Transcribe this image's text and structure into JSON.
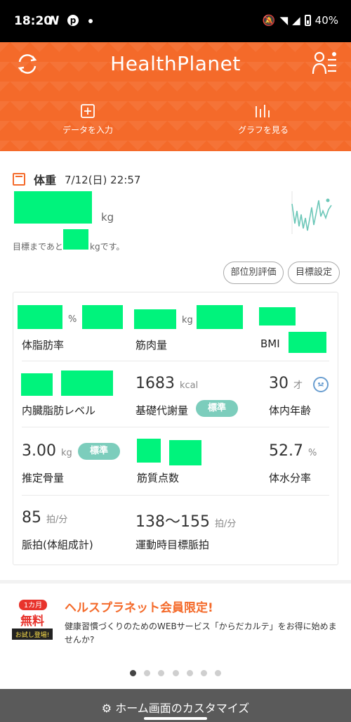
{
  "status": {
    "time": "18:20",
    "battery": "40%"
  },
  "header": {
    "title": "HealthPlanet",
    "actions": [
      {
        "label": "データを入力",
        "icon": "plus-square-icon"
      },
      {
        "label": "グラフを見る",
        "icon": "bar-chart-icon"
      }
    ]
  },
  "weight": {
    "label": "体重",
    "datetime": "7/12(日) 22:57",
    "unit": "kg",
    "goal_prefix": "目標まであと",
    "goal_suffix": "kgです。"
  },
  "buttons": {
    "part_eval": "部位別評価",
    "goal_setting": "目標設定"
  },
  "metrics": {
    "body_fat": {
      "label": "体脂肪率",
      "unit": "%"
    },
    "muscle": {
      "label": "筋肉量",
      "unit": "kg"
    },
    "bmi": {
      "label": "BMI"
    },
    "visceral": {
      "label": "内臓脂肪レベル"
    },
    "bmr": {
      "label": "基礎代謝量",
      "value": "1683",
      "unit": "kcal",
      "badge": "標準"
    },
    "body_age": {
      "label": "体内年齢",
      "value": "30",
      "unit": "才"
    },
    "bone": {
      "label": "推定骨量",
      "value": "3.00",
      "unit": "kg",
      "badge": "標準"
    },
    "muscle_score": {
      "label": "筋質点数"
    },
    "water": {
      "label": "体水分率",
      "value": "52.7",
      "unit": "%"
    },
    "pulse": {
      "label": "脈拍(体組成計)",
      "value": "85",
      "unit": "拍/分"
    },
    "target_pulse": {
      "label": "運動時目標脈拍",
      "value": "138〜155",
      "unit": "拍/分"
    }
  },
  "promo": {
    "badge_text": "1カ月 無料 お試し登場!",
    "title": "ヘルスプラネット会員限定!",
    "text": "健康習慣づくりのためのWEBサービス「からだカルテ」をお得に始めませんか?",
    "dots_total": 7,
    "dots_active": 1
  },
  "bottom": {
    "label": "ホーム画面のカスタマイズ"
  },
  "colors": {
    "accent": "#f46a2a",
    "badge": "#7ccdbc",
    "redacted": "#00f37c"
  }
}
